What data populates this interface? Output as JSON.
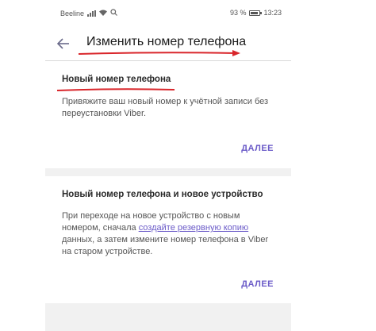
{
  "status_bar": {
    "carrier": "Beeline",
    "battery": "93 %",
    "time": "13:23"
  },
  "app_bar": {
    "back_icon": "arrow-left-icon",
    "title": "Изменить номер телефона"
  },
  "sections": [
    {
      "title": "Новый номер телефона",
      "description": "Привяжите ваш новый номер к учётной записи без переустановки Viber.",
      "button_label": "ДАЛЕЕ"
    },
    {
      "title": "Новый номер телефона и новое устройство",
      "description_before_link": "При переходе на новое устройство с новым номером, сначала ",
      "link_text": "создайте резервную копию",
      "description_after_link": " данных, а затем измените номер телефона в Viber на старом устройстве.",
      "button_label": "ДАЛЕЕ"
    }
  ],
  "colors": {
    "accent": "#6b5bc8",
    "annotation_red": "#d9262b"
  }
}
